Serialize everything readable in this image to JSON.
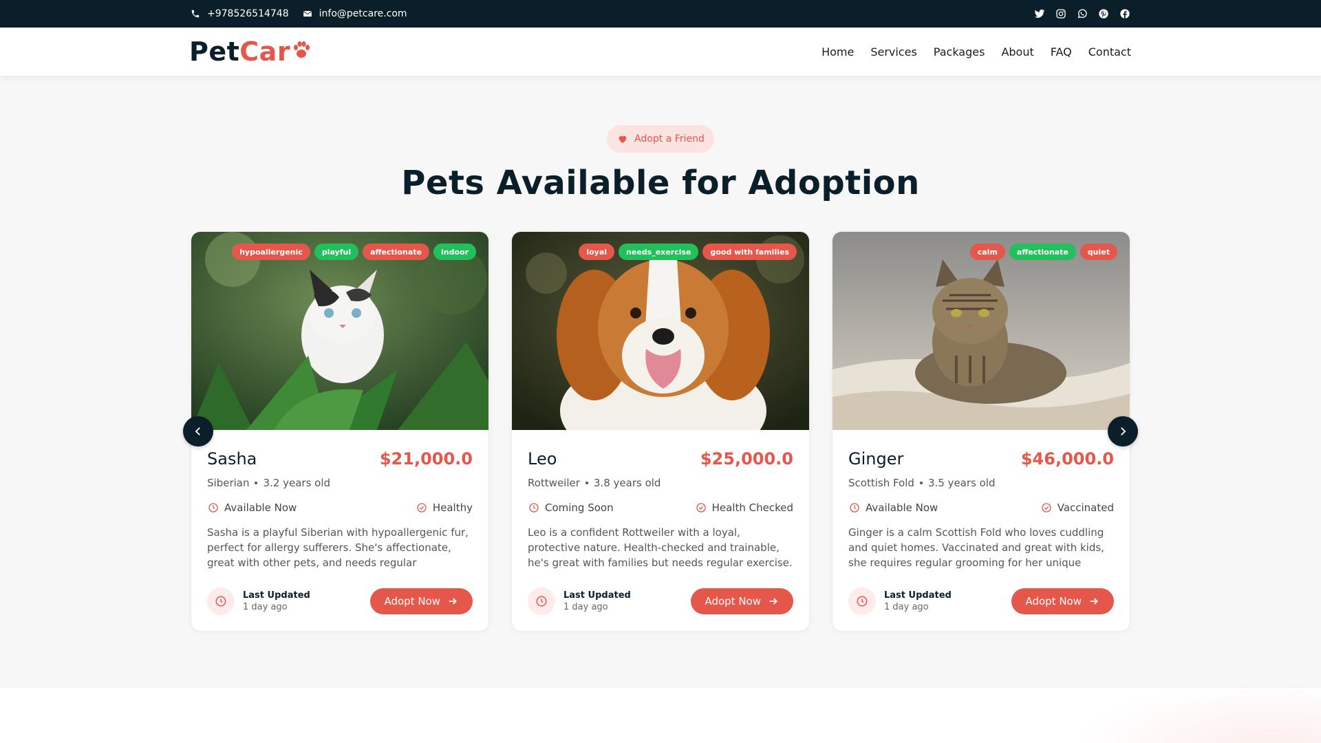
{
  "topbar": {
    "phone": "+978526514748",
    "email": "info@petcare.com",
    "social": [
      "twitter-icon",
      "instagram-icon",
      "whatsapp-icon",
      "pinterest-icon",
      "facebook-icon"
    ]
  },
  "header": {
    "logo_part1": "Pet",
    "logo_part2": "Car",
    "nav": [
      "Home",
      "Services",
      "Packages",
      "About",
      "FAQ",
      "Contact"
    ]
  },
  "section": {
    "badge": "Adopt a Friend",
    "title": "Pets Available for Adoption"
  },
  "pets": [
    {
      "name": "Sasha",
      "price": "$21,000.0",
      "breed": "Siberian",
      "age": "3.2 years old",
      "availability": "Available Now",
      "health": "Healthy",
      "description": "Sasha is a playful Siberian with hypoallergenic fur, perfect for allergy sufferers. She's affectionate, great with other pets, and needs regular grooming....",
      "updated_label": "Last Updated",
      "updated_value": "1 day ago",
      "button": "Adopt Now",
      "tags": [
        {
          "text": "hypoallergenic",
          "color": "red"
        },
        {
          "text": "playful",
          "color": "green"
        },
        {
          "text": "affectionate",
          "color": "red"
        },
        {
          "text": "indoor",
          "color": "green"
        }
      ]
    },
    {
      "name": "Leo",
      "price": "$25,000.0",
      "breed": "Rottweiler",
      "age": "3.8 years old",
      "availability": "Coming Soon",
      "health": "Health Checked",
      "description": "Leo is a confident Rottweiler with a loyal, protective nature. Health-checked and trainable, he's great with families but needs regular exercise. Ideal for...",
      "updated_label": "Last Updated",
      "updated_value": "1 day ago",
      "button": "Adopt Now",
      "tags": [
        {
          "text": "loyal",
          "color": "red"
        },
        {
          "text": "needs_exercise",
          "color": "green"
        },
        {
          "text": "good with families",
          "color": "red"
        }
      ]
    },
    {
      "name": "Ginger",
      "price": "$46,000.0",
      "breed": "Scottish Fold",
      "age": "3.5 years old",
      "availability": "Available Now",
      "health": "Vaccinated",
      "description": "Ginger is a calm Scottish Fold who loves cuddling and quiet homes. Vaccinated and great with kids, she requires regular grooming for her unique ears....",
      "updated_label": "Last Updated",
      "updated_value": "1 day ago",
      "button": "Adopt Now",
      "tags": [
        {
          "text": "calm",
          "color": "red"
        },
        {
          "text": "affectionate",
          "color": "green"
        },
        {
          "text": "quiet",
          "color": "red"
        }
      ]
    }
  ],
  "colors": {
    "dark": "#0b1f2a",
    "accent": "#e4574a",
    "green": "#22c05c"
  }
}
